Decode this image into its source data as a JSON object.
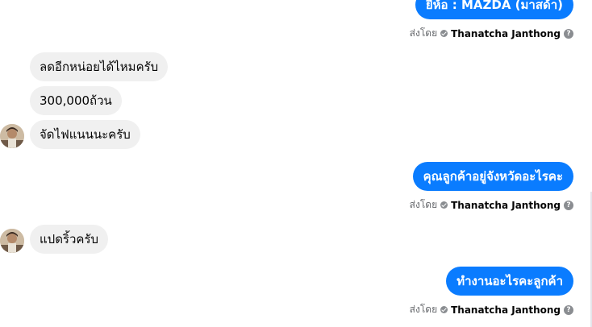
{
  "outgoing": {
    "brand_message": "ยี่ห้อ : MAZDA (มาสด้า)",
    "province_question": "คุณลูกค้าอยู่จังหวัดอะไรคะ",
    "job_question": "ทำงานอะไรคะลูกค้า"
  },
  "sent_by": {
    "prefix": "ส่งโดย",
    "name": "Thanatcha Janthong",
    "help": "?"
  },
  "incoming": {
    "discount_ask": "ลดอีกหน่อยได้ไหมครับ",
    "offer": "300,000ถ้วน",
    "finance": "จัดไฟแนนนะครับ",
    "location": "แปดริ้วครับ"
  }
}
